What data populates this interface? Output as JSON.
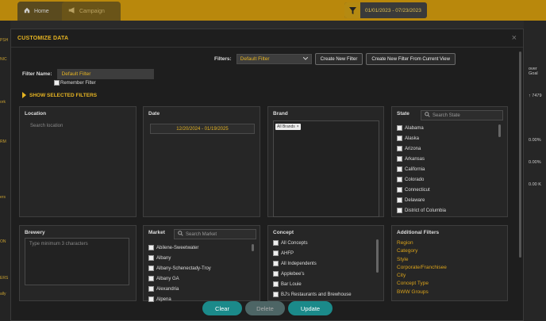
{
  "app": {
    "tabs": [
      {
        "label": "Home"
      },
      {
        "label": "Campaign"
      }
    ],
    "date_range": "01/01/2023 - 07/23/2023",
    "left_labels": [
      "PSH",
      "NIC",
      "ork",
      "RM",
      "ers",
      "ON",
      "ERS",
      "ally"
    ],
    "right_labels": [
      "over Goal",
      "↑ 7479",
      "0.00%",
      "0.00%",
      "0.00 K"
    ]
  },
  "modal": {
    "title": "CUSTOMIZE DATA",
    "close": "×"
  },
  "filters": {
    "label": "Filters:",
    "selected": "Default Filter",
    "create_new": "Create New Filter",
    "create_from_current": "Create New Filter From Current View"
  },
  "filter_name": {
    "label": "Filter Name:",
    "value": "Default Filter",
    "remember": "Remember Filter"
  },
  "show_selected": "SHOW SELECTED FILTERS",
  "location": {
    "title": "Location",
    "placeholder": "Search location"
  },
  "date": {
    "title": "Date",
    "value": "12/20/2024 - 01/19/2025"
  },
  "brand": {
    "title": "Brand",
    "tag": "All Brands",
    "tag_close": "×"
  },
  "state": {
    "title": "State",
    "search_placeholder": "Search State",
    "items": [
      "Alabama",
      "Alaska",
      "Arizona",
      "Arkansas",
      "California",
      "Colorado",
      "Connecticut",
      "Delaware",
      "District of Columbia"
    ]
  },
  "brewery": {
    "title": "Brewery",
    "placeholder": "Type minimum 3 characters"
  },
  "market": {
    "title": "Market",
    "search_placeholder": "Search Market",
    "items": [
      "Abilene-Sweetwater",
      "Albany",
      "Albany-Schenectady-Troy",
      "Albany GA",
      "Alexandria",
      "Alpena"
    ]
  },
  "concept": {
    "title": "Concept",
    "items": [
      "All Concepts",
      "AHFP",
      "All Independents",
      "Applebee's",
      "Bar Louie",
      "BJ's Restaurants and Brewhouse"
    ]
  },
  "additional": {
    "title": "Additional Filters",
    "links": [
      "Region",
      "Category",
      "Style",
      "Corporate/Franchisee",
      "City",
      "Concept Type",
      "BWW Groups"
    ]
  },
  "footer": {
    "clear": "Clear",
    "delete": "Delete",
    "update": "Update"
  },
  "colors": {
    "accent": "#e6b422",
    "teal": "#1b8a8a",
    "header_bar": "#b9880c"
  }
}
